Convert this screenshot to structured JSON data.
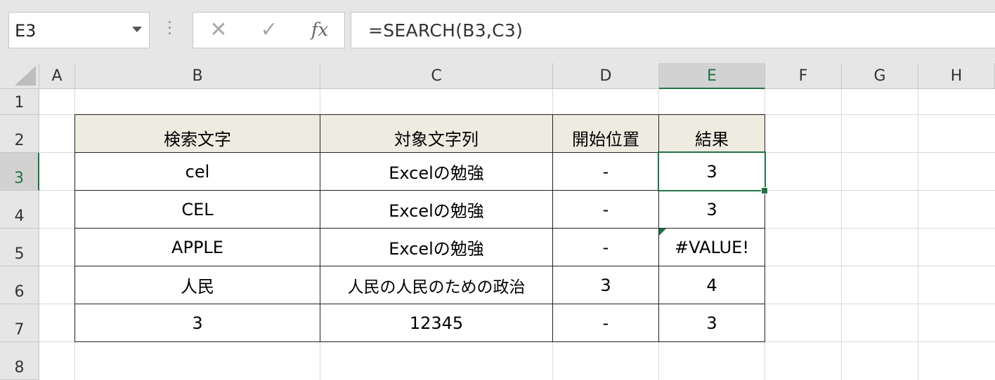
{
  "name_box": {
    "value": "E3",
    "dropdown_icon": "chevron-down-icon"
  },
  "formula_bar": {
    "cancel_icon": "✕",
    "enter_icon": "✓",
    "fx_label": "fx",
    "formula": "=SEARCH(B3,C3)"
  },
  "columns": [
    "A",
    "B",
    "C",
    "D",
    "E",
    "F",
    "G",
    "H"
  ],
  "rows": [
    "1",
    "2",
    "3",
    "4",
    "5",
    "6",
    "7",
    "8"
  ],
  "selected_cell": "E3",
  "table": {
    "headers": [
      "検索文字",
      "対象文字列",
      "開始位置",
      "結果"
    ],
    "rows": [
      [
        "cel",
        "Excelの勉強",
        "-",
        "3"
      ],
      [
        "CEL",
        "Excelの勉強",
        "-",
        "3"
      ],
      [
        "APPLE",
        "Excelの勉強",
        "-",
        "#VALUE!"
      ],
      [
        "人民",
        "人民の人民のための政治",
        "3",
        "4"
      ],
      [
        "3",
        "12345",
        "-",
        "3"
      ]
    ]
  },
  "colors": {
    "accent": "#217346",
    "header_fill": "#eeece1",
    "chrome": "#e6e6e6"
  }
}
